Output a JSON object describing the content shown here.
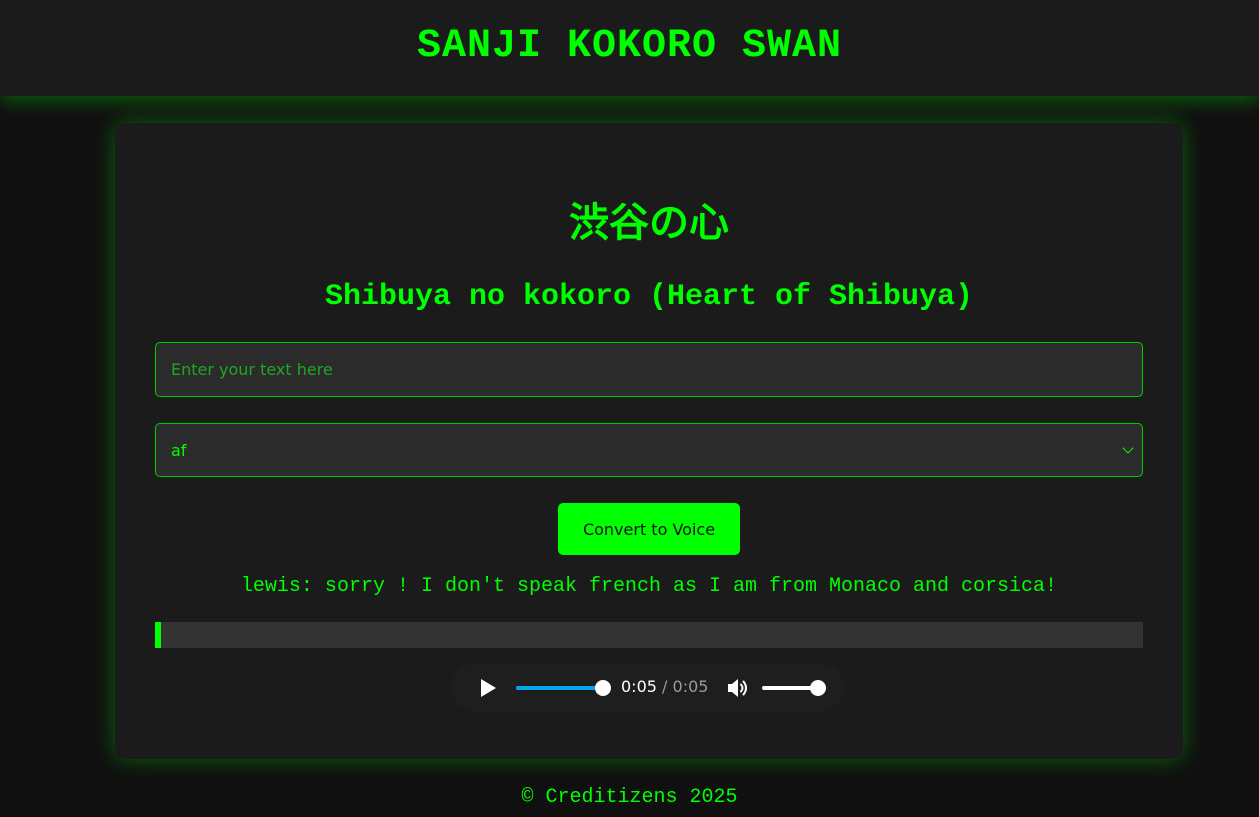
{
  "header": {
    "title": "SANJI KOKORO SWAN"
  },
  "main": {
    "jp_title": "渋谷の心",
    "subtitle": "Shibuya no kokoro (Heart of Shibuya)",
    "text_input": {
      "value": "",
      "placeholder": "Enter your text here"
    },
    "language_select": {
      "selected": "af"
    },
    "convert_button_label": "Convert to Voice",
    "message": "lewis: sorry ! I don't speak french as I am from Monaco and corsica!",
    "progress": {
      "fraction": 0.006
    },
    "audio": {
      "current_time": "0:05",
      "separator": "/",
      "total_time": "0:05",
      "played_fraction": 1.0,
      "volume_fraction": 1.0
    }
  },
  "footer": {
    "text": "© Creditizens 2025"
  },
  "colors": {
    "accent": "#00ff00",
    "background": "#101010",
    "panel": "#1b1b1b",
    "input_bg": "#2b2b2b",
    "seek_blue": "#00a8e8"
  },
  "icons": {
    "play": "play-icon",
    "volume": "volume-icon",
    "dropdown": "chevron-down-icon"
  }
}
